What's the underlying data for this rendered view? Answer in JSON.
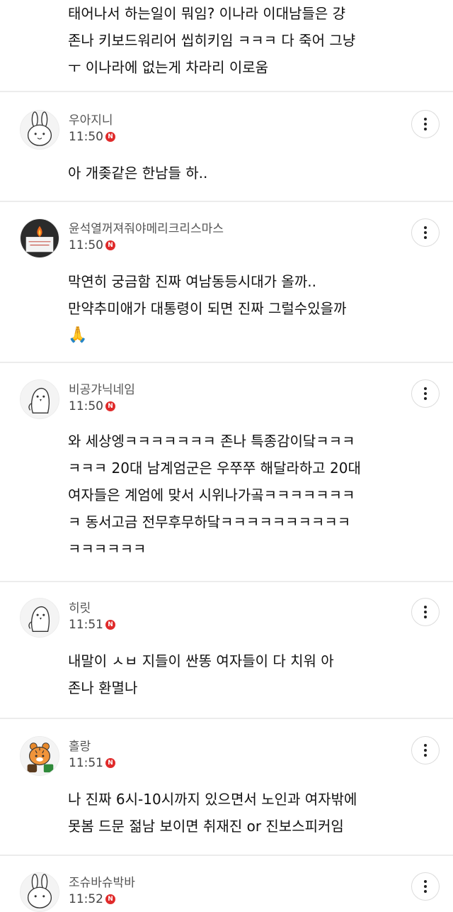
{
  "top_comment": {
    "lines": [
      "태어나서 하는일이 뭐임? 이나라 이대남들은 걍",
      "존나 키보드워리어 씹히키임 ㅋㅋㅋ 다 죽어 그냥",
      "ㅜ 이나라에 없는게 차라리 이로움"
    ]
  },
  "comments": [
    {
      "username": "우아지니",
      "time": "11:50",
      "badge": "N",
      "avatar_icon": "rabbit-icon",
      "lines": [
        "아 개좆같은 한남들 하.."
      ]
    },
    {
      "username": "윤석열꺼져줘야메리크리스마스",
      "time": "11:50",
      "badge": "N",
      "avatar_icon": "candle-icon",
      "lines": [
        "막연히 궁금함 진짜 여남동등시대가 올까..",
        "만약추미애가 대통령이 되면 진짜 그럴수있을까",
        "🙏"
      ]
    },
    {
      "username": "비공갸닉네임",
      "time": "11:50",
      "badge": "N",
      "avatar_icon": "penguin-icon",
      "lines": [
        "와 세상엥ㅋㅋㅋㅋㅋㅋㅋ 존나 특종감이닼ㅋㅋㅋ",
        "ㅋㅋㅋ 20대 남계엄군은 우쭈쭈 해달라하고 20대",
        "여자들은 계엄에 맞서 시위나가곸ㅋㅋㅋㅋㅋㅋㅋ",
        "ㅋ 동서고금 전무후무하닼ㅋㅋㅋㅋㅋㅋㅋㅋㅋㅋ",
        "ㅋㅋㅋㅋㅋㅋ"
      ]
    },
    {
      "username": "히릿",
      "time": "11:51",
      "badge": "N",
      "avatar_icon": "penguin-icon",
      "lines": [
        "내말이 ㅅㅂ 지들이 싼똥 여자들이 다 치워 아",
        "존나 환멸나"
      ]
    },
    {
      "username": "홀랑",
      "time": "11:51",
      "badge": "N",
      "avatar_icon": "tiger-icon",
      "lines": [
        "나 진짜 6시-10시까지 있으면서 노인과 여자밖에",
        "못봄 드문 젊남 보이면 취재진 or 진보스피커임"
      ]
    },
    {
      "username": "조슈바슈박바",
      "time": "11:52",
      "badge": "N",
      "avatar_icon": "rabbit-icon",
      "lines": []
    }
  ],
  "colors": {
    "badge": "#e02b2b",
    "username": "#555555",
    "separator": "#ececec"
  },
  "icons": {
    "more": "more-vertical-icon",
    "badge": "new-badge"
  }
}
